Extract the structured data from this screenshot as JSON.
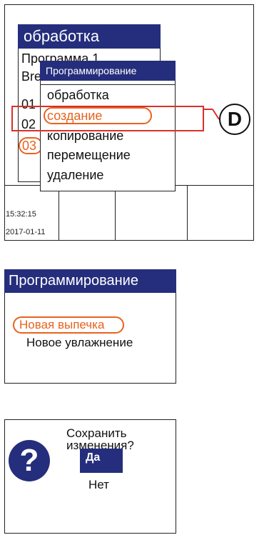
{
  "panel1": {
    "bg_window": {
      "title": "обработка",
      "lines": [
        "Программа 1",
        "Bre",
        "01",
        "02",
        "03"
      ]
    },
    "popup": {
      "title": "Программирование",
      "items": [
        "обработка",
        "создание",
        "копирование",
        "перемещение",
        "удаление"
      ],
      "highlighted_item": "создание"
    },
    "status": {
      "time": "15:32:15",
      "date": "2017-01-11"
    },
    "callout_label": "D",
    "colors": {
      "title_bar": "#252e7c",
      "highlight_oval": "#e8621f",
      "callout_rect": "#d9302b"
    }
  },
  "panel2": {
    "title": "Программирование",
    "items": [
      "Новая выпечка",
      "Новое увлажнение"
    ],
    "highlighted_item": "Новая выпечка"
  },
  "panel3": {
    "icon": "question-icon",
    "message_line1": "Сохранить",
    "message_line2": "изменения?",
    "yes_label": "Да",
    "no_label": "Нет"
  }
}
